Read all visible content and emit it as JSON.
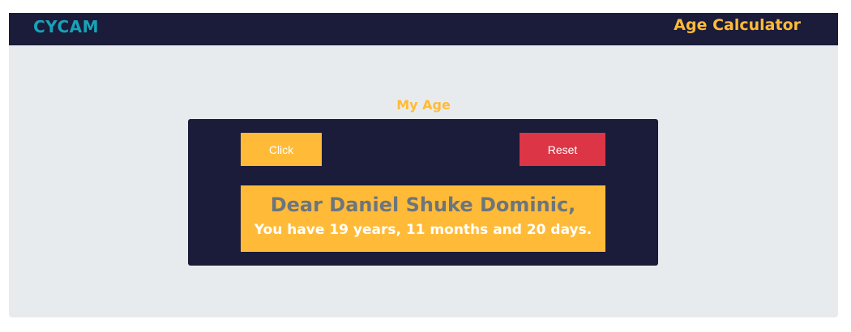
{
  "navbar": {
    "brand": "CYCAM",
    "title": "Age Calculator"
  },
  "main": {
    "section_title": "My Age",
    "buttons": {
      "click_label": "Click",
      "reset_label": "Reset"
    },
    "result": {
      "greeting": "Dear Daniel Shuke Dominic,",
      "age_text": "You have 19 years, 11 months and 20 days."
    }
  },
  "colors": {
    "navbar_bg": "#1b1b3a",
    "brand": "#17a2b8",
    "accent": "#ffbb38",
    "danger": "#dc3545",
    "page_bg": "#e8ebee",
    "greeting_text": "#6c757d"
  }
}
